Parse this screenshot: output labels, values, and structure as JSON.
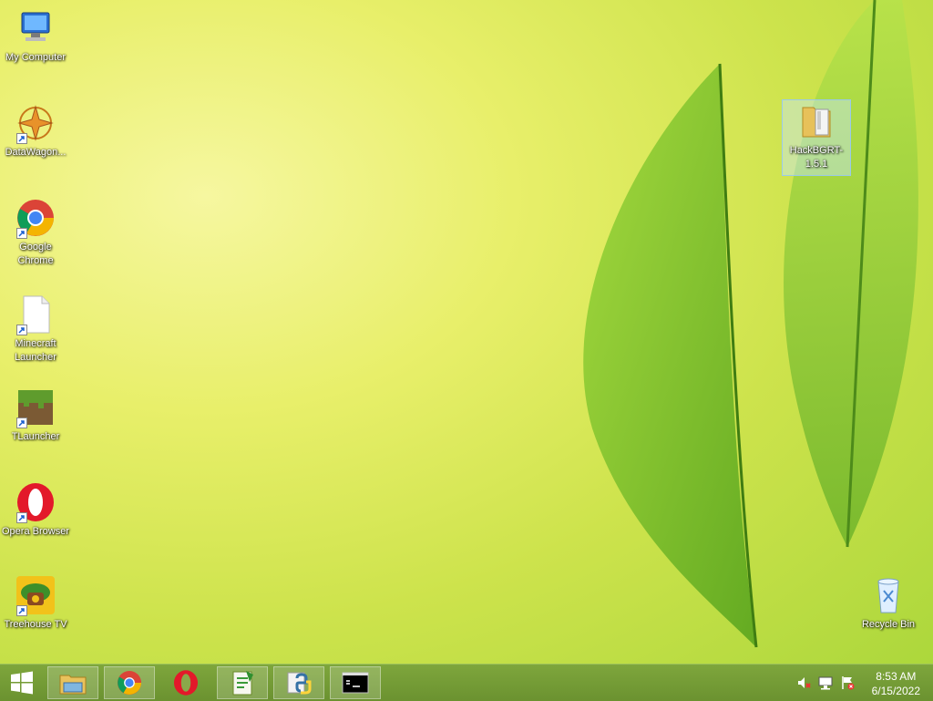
{
  "desktop": {
    "icons": [
      {
        "label": "My Computer"
      },
      {
        "label": "DataWagon..."
      },
      {
        "label": "Google Chrome"
      },
      {
        "label": "Minecraft Launcher"
      },
      {
        "label": "TLauncher"
      },
      {
        "label": "Opera Browser"
      },
      {
        "label": "Treehouse TV"
      },
      {
        "label": "HackBGRT-1.5.1"
      },
      {
        "label": "Recycle Bin"
      }
    ]
  },
  "taskbar": {
    "clock_time": "8:53 AM",
    "clock_date": "6/15/2022",
    "buttons": [
      "start-icon",
      "file-explorer-icon",
      "chrome-icon",
      "opera-icon",
      "notepadpp-icon",
      "python-icon",
      "cmd-icon"
    ]
  },
  "colors": {
    "wallpaper_light": "#f6f7a0",
    "wallpaper_dark": "#a9d63a",
    "taskbar": "#6b9230"
  }
}
